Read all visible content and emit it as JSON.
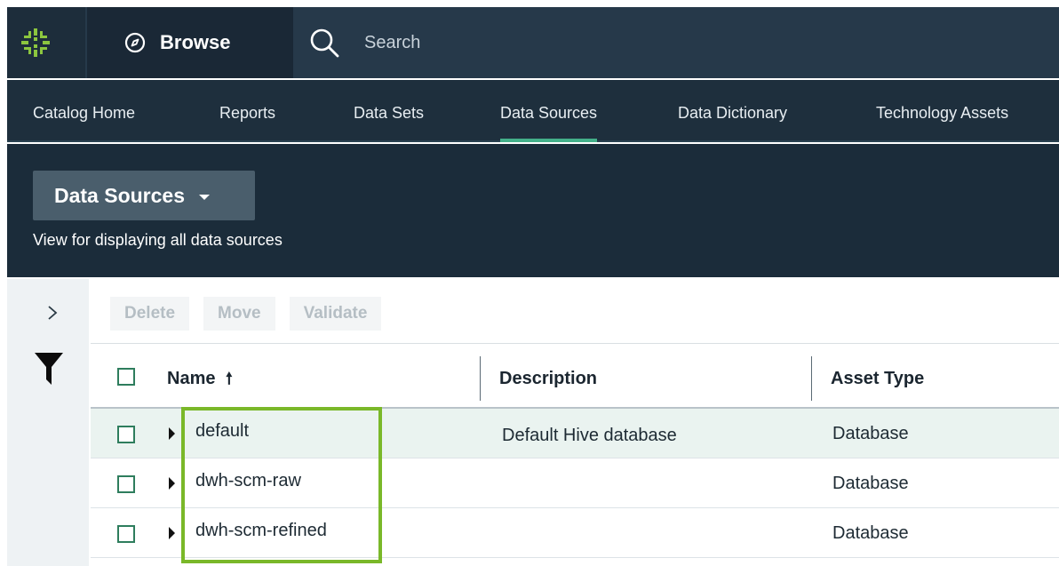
{
  "topbar": {
    "browse_label": "Browse",
    "search_placeholder": "Search",
    "logo_icon": "tamr-logo-icon",
    "accent_color": "#7ab829"
  },
  "nav": {
    "tabs": [
      {
        "label": "Catalog Home",
        "active": false
      },
      {
        "label": "Reports",
        "active": false
      },
      {
        "label": "Data Sets",
        "active": false
      },
      {
        "label": "Data Sources",
        "active": true
      },
      {
        "label": "Data Dictionary",
        "active": false
      },
      {
        "label": "Technology Assets",
        "active": false
      }
    ]
  },
  "header": {
    "view_title": "Data Sources",
    "view_description": "View for displaying all data sources"
  },
  "sidebar": {
    "expand_icon": "chevron-right-icon",
    "filter_icon": "filter-icon"
  },
  "toolbar": {
    "delete_label": "Delete",
    "move_label": "Move",
    "validate_label": "Validate"
  },
  "table": {
    "columns": [
      {
        "label": "Name",
        "sort": "ascending"
      },
      {
        "label": "Description"
      },
      {
        "label": "Asset Type"
      }
    ],
    "sort_arrow": "🠕",
    "rows": [
      {
        "name": "default",
        "description": "Default Hive database",
        "type": "Database"
      },
      {
        "name": "dwh-scm-raw",
        "description": "",
        "type": "Database"
      },
      {
        "name": "dwh-scm-refined",
        "description": "",
        "type": "Database"
      }
    ]
  },
  "colors": {
    "active_tab_underline": "#44b08a",
    "checkbox_border": "#2e7d5d",
    "highlight_border": "#7ab829"
  }
}
